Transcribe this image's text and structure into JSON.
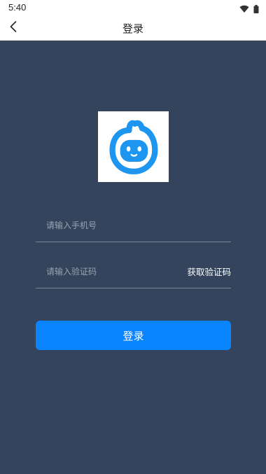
{
  "status_bar": {
    "time": "5:40",
    "icons": [
      "wifi-icon",
      "battery-icon"
    ]
  },
  "nav": {
    "back_icon": "chevron-left-icon",
    "title": "登录"
  },
  "logo": {
    "icon": "app-logo-icon",
    "accent_color": "#1e96f0"
  },
  "form": {
    "phone_placeholder": "请输入手机号",
    "phone_value": "",
    "code_placeholder": "请输入验证码",
    "code_value": "",
    "get_code_label": "获取验证码",
    "login_label": "登录"
  },
  "colors": {
    "background": "#34445c",
    "primary_button": "#0a84ff",
    "top_bar": "#ffffff"
  }
}
